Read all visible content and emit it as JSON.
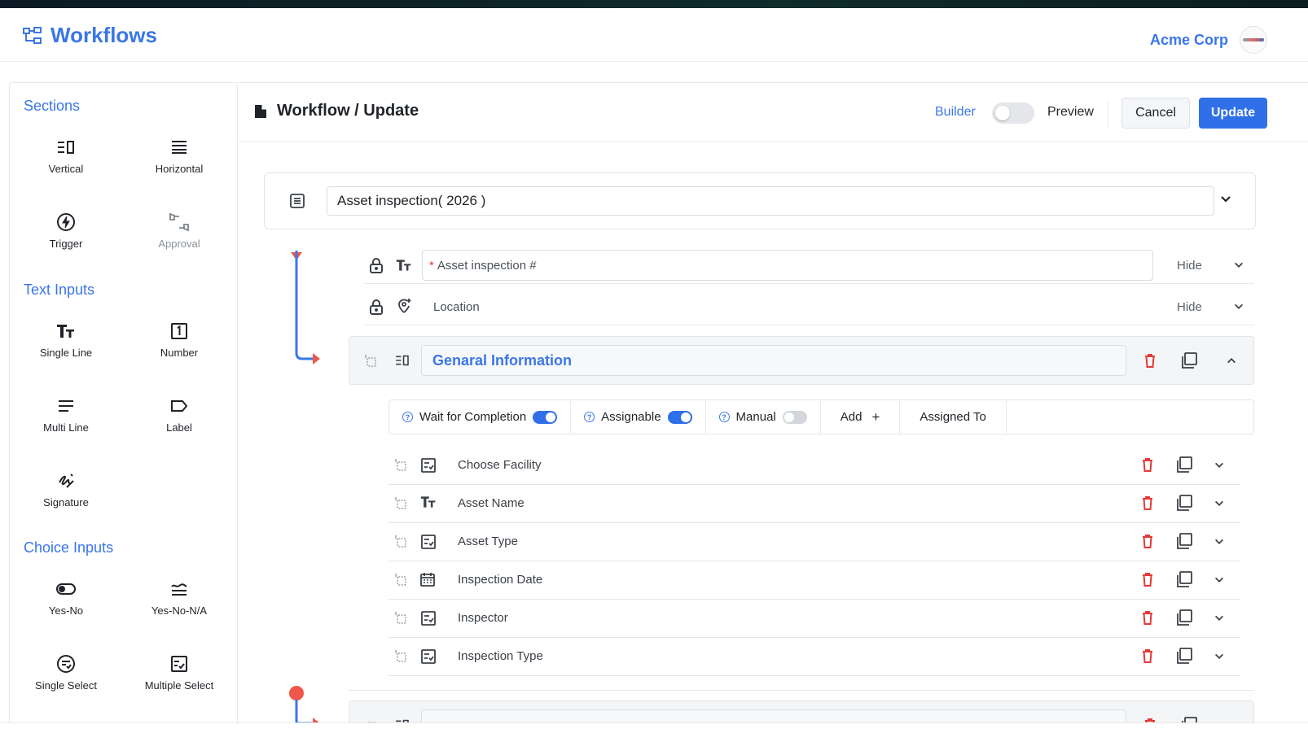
{
  "app": {
    "title": "Workflows",
    "org_name": "Acme Corp"
  },
  "sidebar": {
    "sections": [
      {
        "title": "Sections",
        "tools": [
          {
            "label": "Vertical",
            "icon": "vertical-layout-icon"
          },
          {
            "label": "Horizontal",
            "icon": "horizontal-layout-icon"
          },
          {
            "label": "Trigger",
            "icon": "lightning-icon"
          },
          {
            "label": "Approval",
            "icon": "approval-icon",
            "disabled": true
          }
        ]
      },
      {
        "title": "Text Inputs",
        "tools": [
          {
            "label": "Single Line",
            "icon": "text-size-icon"
          },
          {
            "label": "Number",
            "icon": "number-box-icon"
          },
          {
            "label": "Multi Line",
            "icon": "multi-line-icon"
          },
          {
            "label": "Label",
            "icon": "tag-icon"
          },
          {
            "label": "Signature",
            "icon": "signature-icon"
          }
        ]
      },
      {
        "title": "Choice Inputs",
        "tools": [
          {
            "label": "Yes-No",
            "icon": "toggle-icon"
          },
          {
            "label": "Yes-No-N/A",
            "icon": "approx-equal-icon"
          },
          {
            "label": "Single Select",
            "icon": "single-select-icon"
          },
          {
            "label": "Multiple Select",
            "icon": "multi-select-icon"
          }
        ]
      }
    ]
  },
  "main": {
    "title": "Workflow / Update",
    "mode_builder": "Builder",
    "mode_preview": "Preview",
    "builder_enabled": false,
    "cancel_label": "Cancel",
    "update_label": "Update",
    "workflow_name": "Asset inspection( 2026 )",
    "top_fields": [
      {
        "placeholder": "Asset inspection #",
        "required": true,
        "icon": "text-size-icon",
        "visibility": "Hide"
      },
      {
        "placeholder": "Location",
        "required": false,
        "icon": "location-pin-icon",
        "visibility": "Hide"
      }
    ],
    "group": {
      "title": "Genaral Information",
      "options": [
        {
          "label": "Wait for Completion",
          "on": true
        },
        {
          "label": "Assignable",
          "on": true
        },
        {
          "label": "Manual",
          "on": false
        }
      ],
      "add_label": "Add",
      "assigned_to_label": "Assigned To",
      "fields": [
        {
          "label": "Choose Facility",
          "icon": "select-box-icon"
        },
        {
          "label": "Asset Name",
          "icon": "text-size-icon"
        },
        {
          "label": "Asset Type",
          "icon": "select-box-icon"
        },
        {
          "label": "Inspection Date",
          "icon": "calendar-icon"
        },
        {
          "label": "Inspector",
          "icon": "select-box-icon"
        },
        {
          "label": "Inspection Type",
          "icon": "select-box-icon"
        }
      ]
    }
  },
  "colors": {
    "accent": "#3b76e8",
    "primary_button": "#2f6fe8",
    "danger": "#e53935",
    "flow_start": "#f0574b"
  }
}
